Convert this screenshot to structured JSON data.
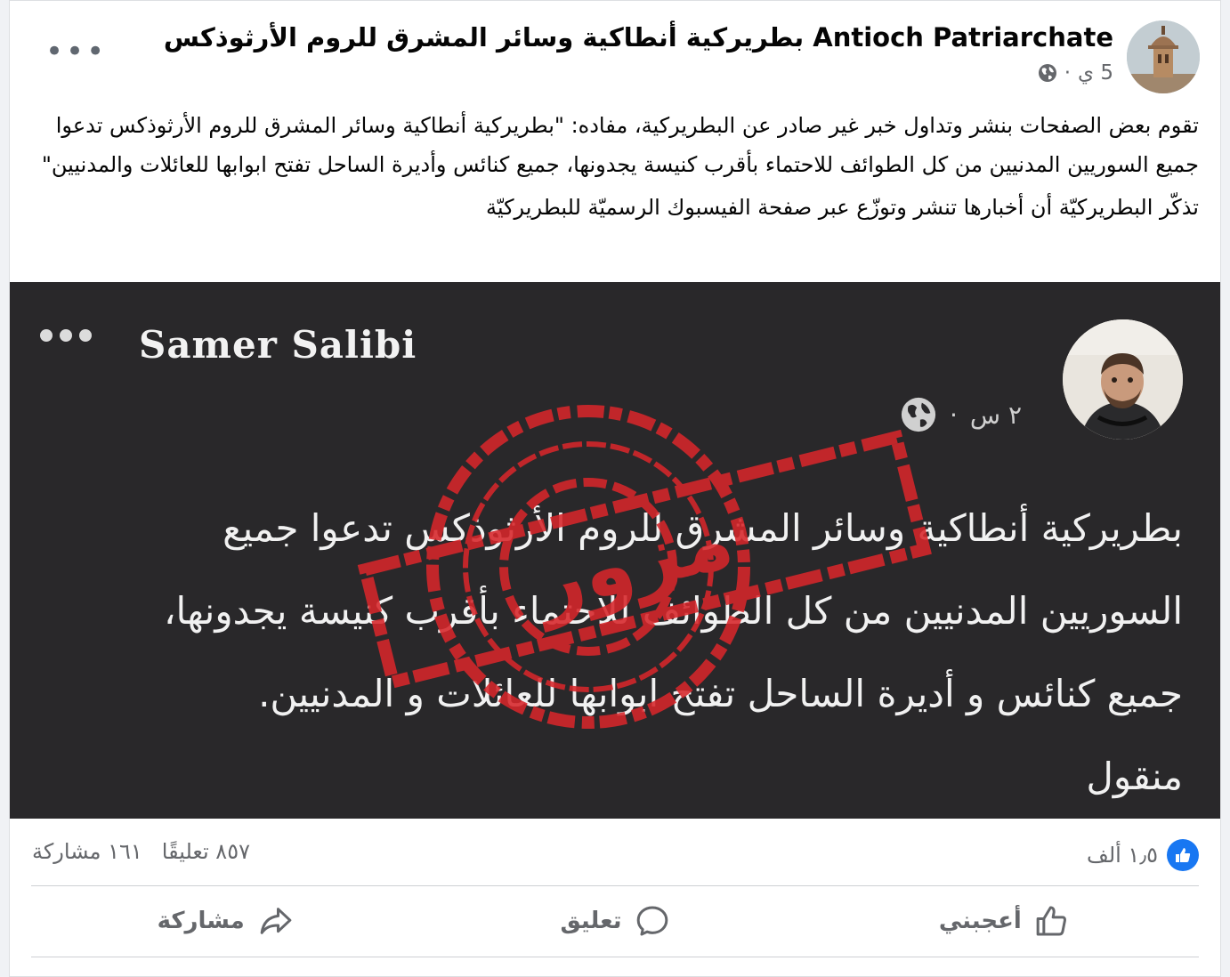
{
  "post": {
    "page_name": "Antioch Patriarchate بطريركية أنطاكية وسائر المشرق للروم الأرثوذكس",
    "time": "5 ي",
    "separator": "·",
    "paragraph1": "تقوم بعض الصفحات بنشر وتداول خبر غير صادر عن البطريركية، مفاده: \"بطريركية أنطاكية وسائر المشرق للروم الأرثوذكس تدعوا جميع السوريين المدنيين من كل الطوائف  للاحتماء  بأقرب كنيسة يجدونها،    جميع كنائس وأديرة الساحل تفتح ابوابها للعائلات والمدنيين\"",
    "paragraph2": "تذكّر البطريركيّة أن أخبارها تنشر وتوزّع عبر صفحة الفيسبوك الرسميّة للبطريركيّة"
  },
  "shared_post": {
    "author": "Samer Salibi",
    "time": "٢ س",
    "separator": "·",
    "lines": [
      "بطريركية أنطاكية وسائر المشرق للروم الأرثوذكس تدعوا جميع",
      "السوريين المدنيين من كل الطوائف للاحتماء بأقرب كنيسة يجدونها،",
      "جميع كنائس و أديرة الساحل تفتح ابوابها للعائلات و المدنيين.",
      "منقول"
    ],
    "stamp_text": "مزور",
    "stamp_color": "#d7262a"
  },
  "stats": {
    "reactions_count": "١٫٥ ألف",
    "comments": "٨٥٧ تعليقًا",
    "shares": "١٦١ مشاركة"
  },
  "actions": {
    "like": "أعجبني",
    "comment": "تعليق",
    "share": "مشاركة"
  },
  "icons": {
    "globe": "globe-icon",
    "more": "more-options-icon",
    "like": "thumbs-up-icon",
    "comment": "comment-bubble-icon",
    "share": "share-arrow-icon"
  },
  "colors": {
    "facebook_blue": "#1877f2",
    "secondary_text": "#65676b"
  }
}
